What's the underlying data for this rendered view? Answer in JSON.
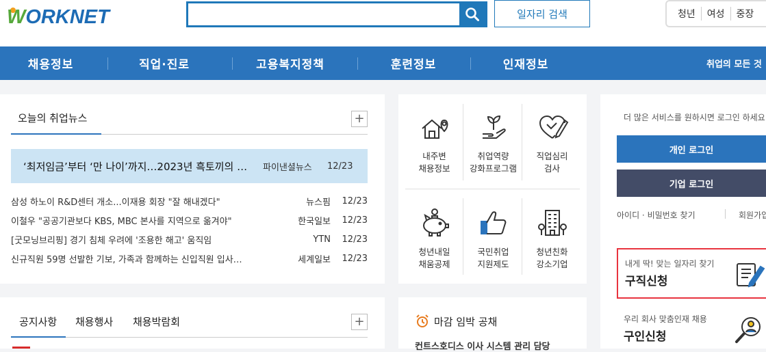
{
  "header": {
    "logo_w": "W",
    "logo_rest": "ORKNET",
    "search_placeholder": "",
    "job_search_label": "일자리 검색",
    "audience": [
      "청년",
      "여성",
      "중장"
    ]
  },
  "nav": {
    "items": [
      "채용정보",
      "직업·진로",
      "고용복지정책",
      "훈련정보",
      "인재정보"
    ],
    "tagline": "취업의 모든 것"
  },
  "news": {
    "tab_label": "오늘의 취업뉴스",
    "plus": "+",
    "headline": {
      "title": "‘최저임금’부터 ‘만 나이’까지…2023년 흑토끼의 …",
      "source": "파이낸셜뉴스",
      "date": "12/23"
    },
    "rows": [
      {
        "title": "삼성 하노이 R&D센터 개소...이재용 회장 \"잘 해내겠다\"",
        "source": "뉴스핌",
        "date": "12/23"
      },
      {
        "title": "이철우 \"공공기관보다 KBS, MBC 본사를 지역으로 옮겨야\"",
        "source": "한국일보",
        "date": "12/23"
      },
      {
        "title": "[굿모닝브리핑] 경기 침체 우려에 '조용한 해고' 움직임",
        "source": "YTN",
        "date": "12/23"
      },
      {
        "title": "신규직원 59명 선발한 기보, 가족과 함께하는 신입직원 입사…",
        "source": "세계일보",
        "date": "12/23"
      }
    ]
  },
  "notice": {
    "tabs": [
      "공지사항",
      "채용행사",
      "채용박람회"
    ],
    "plus": "+"
  },
  "services": [
    {
      "label1": "내주변",
      "label2": "채용정보",
      "icon": "house-location-icon"
    },
    {
      "label1": "취업역량",
      "label2": "강화프로그램",
      "icon": "sprout-hand-icon"
    },
    {
      "label1": "직업심리",
      "label2": "검사",
      "icon": "heart-pen-icon"
    },
    {
      "label1": "청년내일",
      "label2": "채움공제",
      "icon": "piggy-bank-icon"
    },
    {
      "label1": "국민취업",
      "label2": "지원제도",
      "icon": "thumbs-up-icon"
    },
    {
      "label1": "청년친화",
      "label2": "강소기업",
      "icon": "building-icon"
    }
  ],
  "deadline": {
    "title": "마감 임박 공채",
    "first_item": "컨트스호디스 이사 시스템 관리 담당"
  },
  "side": {
    "hint": "더 많은 서비스를 원하시면 로그인 하세요.",
    "personal_login": "개인 로그인",
    "company_login": "기업 로그인",
    "find_account": "아이디 · 비밀번호 찾기",
    "signup": "회원가입",
    "apply_small": "내게 딱! 맞는 일자리 찾기",
    "apply_large": "구직신청",
    "recruit_small": "우리 회사 맞춤인재 채용",
    "recruit_large": "구인신청"
  },
  "colors": {
    "brand_blue": "#2b74bc",
    "brand_green": "#56a83b",
    "highlight_red": "#e8333e",
    "dark_navy": "#434c67"
  }
}
